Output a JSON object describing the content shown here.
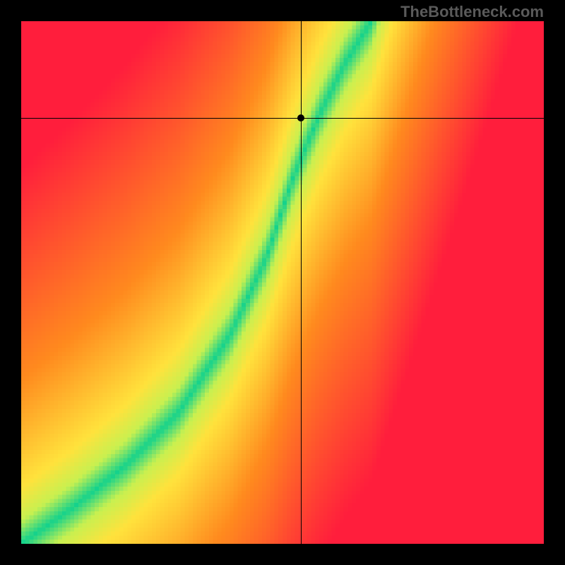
{
  "watermark": "TheBottleneck.com",
  "chart_data": {
    "type": "heatmap",
    "title": "",
    "xlabel": "",
    "ylabel": "",
    "xlim": [
      0,
      1
    ],
    "ylim": [
      0,
      1
    ],
    "crosshair": {
      "x": 0.535,
      "y": 0.815
    },
    "marker": {
      "x": 0.535,
      "y": 0.815
    },
    "optimal_curve": [
      {
        "x": 0.0,
        "y": 0.0
      },
      {
        "x": 0.1,
        "y": 0.07
      },
      {
        "x": 0.2,
        "y": 0.15
      },
      {
        "x": 0.3,
        "y": 0.25
      },
      {
        "x": 0.4,
        "y": 0.4
      },
      {
        "x": 0.47,
        "y": 0.55
      },
      {
        "x": 0.52,
        "y": 0.7
      },
      {
        "x": 0.57,
        "y": 0.82
      },
      {
        "x": 0.62,
        "y": 0.92
      },
      {
        "x": 0.67,
        "y": 1.0
      }
    ],
    "color_stops": {
      "red": "#ff1e3c",
      "orange": "#ff8a1e",
      "yellow": "#ffe23c",
      "ygreen": "#c8f050",
      "green": "#14d28c"
    },
    "grid_resolution": 128
  }
}
